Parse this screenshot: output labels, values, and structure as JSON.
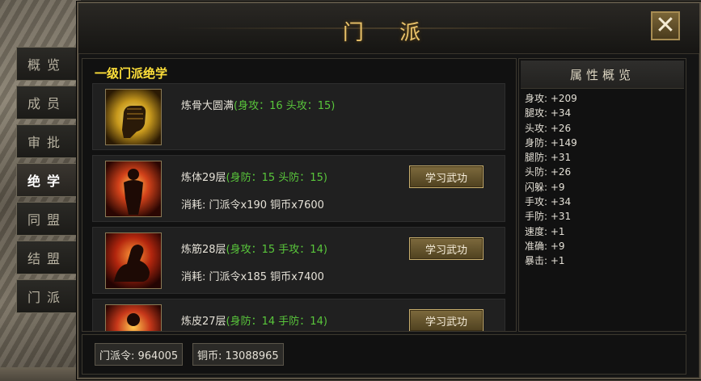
{
  "window": {
    "title": "门 派",
    "close_label": "✕"
  },
  "tabs": [
    {
      "label": "概览",
      "active": false
    },
    {
      "label": "成员",
      "active": false
    },
    {
      "label": "审批",
      "active": false
    },
    {
      "label": "绝学",
      "active": true
    },
    {
      "label": "同盟",
      "active": false
    },
    {
      "label": "结盟",
      "active": false
    },
    {
      "label": "门派",
      "active": false
    }
  ],
  "section_title": "一级门派绝学",
  "skills": [
    {
      "name": "炼骨大圆满",
      "stats": "(身攻：16 头攻：15)",
      "cost": "",
      "button": "",
      "icon": "fist-icon"
    },
    {
      "name": "炼体29层",
      "stats": "(身防：15 头防：15)",
      "cost": "消耗: 门派令x190 铜币x7600",
      "button": "学习武功",
      "icon": "flame-body-icon"
    },
    {
      "name": "炼筋28层",
      "stats": "(身攻：15 手攻：14)",
      "cost": "消耗: 门派令x185 铜币x7400",
      "button": "学习武功",
      "icon": "flexed-arm-icon"
    },
    {
      "name": "炼皮27层",
      "stats": "(身防：14 手防：14)",
      "cost": "",
      "button": "学习武功",
      "icon": "flame-figure-icon"
    }
  ],
  "attributes": {
    "title": "属性概览",
    "items": [
      "身攻: +209",
      "腿攻: +34",
      "头攻: +26",
      "身防: +149",
      "腿防: +31",
      "头防: +26",
      "闪躲: +9",
      "手攻: +34",
      "手防: +31",
      "速度: +1",
      "准确: +9",
      "暴击: +1"
    ]
  },
  "currency": {
    "token": "门派令: 964005",
    "copper": "铜币: 13088965"
  },
  "colors": {
    "title_gold": "#e9c26a",
    "section_yellow": "#ffe03a",
    "stat_green": "#59c63b"
  }
}
